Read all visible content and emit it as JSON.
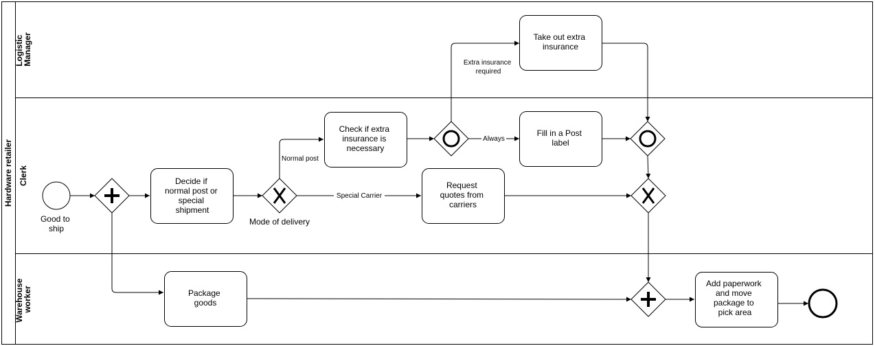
{
  "pool": {
    "name": "Hardware retailer"
  },
  "lanes": [
    {
      "id": "logistic",
      "name_lines": [
        "Logistic",
        "Manager"
      ]
    },
    {
      "id": "clerk",
      "name_lines": [
        "Clerk"
      ]
    },
    {
      "id": "warehouse",
      "name_lines": [
        "Warehouse",
        "worker"
      ]
    }
  ],
  "events": {
    "start": {
      "label_lines": [
        "Good to",
        "ship"
      ],
      "type": "start"
    },
    "end": {
      "label_lines": [],
      "type": "end"
    }
  },
  "gateways": {
    "parallel_split": {
      "type": "parallel",
      "symbol": "plus-icon"
    },
    "mode_of_delivery": {
      "type": "exclusive",
      "symbol": "x-icon",
      "label": "Mode of delivery"
    },
    "inclusive_split": {
      "type": "inclusive",
      "symbol": "circle-icon"
    },
    "inclusive_join": {
      "type": "inclusive",
      "symbol": "circle-icon"
    },
    "exclusive_join": {
      "type": "exclusive",
      "symbol": "x-icon"
    },
    "parallel_join": {
      "type": "parallel",
      "symbol": "plus-icon"
    }
  },
  "tasks": {
    "decide": {
      "lines": [
        "Decide if",
        "normal post or",
        "special",
        "shipment"
      ]
    },
    "check_insurance": {
      "lines": [
        "Check if extra",
        "insurance is",
        "necessary"
      ]
    },
    "take_insurance": {
      "lines": [
        "Take out extra",
        "insurance"
      ]
    },
    "fill_label": {
      "lines": [
        "Fill in a Post",
        "label"
      ]
    },
    "request_quotes": {
      "lines": [
        "Request",
        "quotes from",
        "carriers"
      ]
    },
    "package_goods": {
      "lines": [
        "Package",
        "goods"
      ]
    },
    "add_paperwork": {
      "lines": [
        "Add paperwork",
        "and move",
        "package to",
        "pick area"
      ]
    }
  },
  "flow_labels": {
    "normal_post": "Normal post",
    "special_carrier": "Special Carrier",
    "extra_insurance_required": [
      "Extra insurance",
      "required"
    ],
    "always": "Always"
  },
  "colors": {
    "stroke": "#000000",
    "fill": "#ffffff",
    "text": "#000000"
  }
}
